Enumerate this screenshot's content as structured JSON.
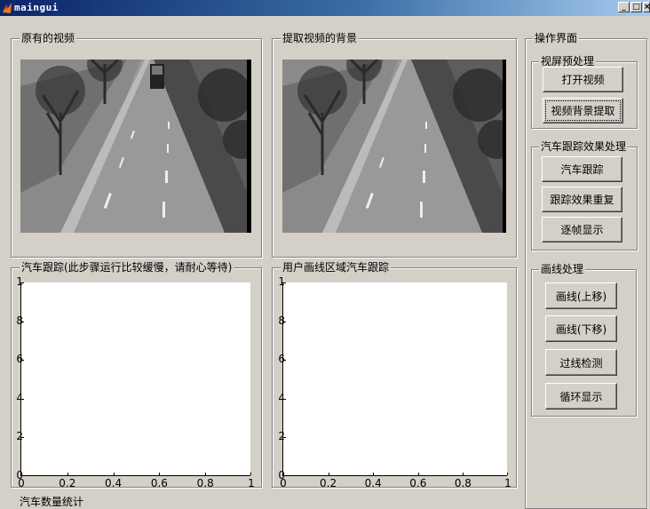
{
  "window": {
    "title": "maingui",
    "minimize_glyph": "_",
    "maximize_glyph": "□",
    "close_glyph": "×"
  },
  "panels": {
    "original_video": {
      "title": "原有的视频"
    },
    "background_video": {
      "title": "提取视频的背景"
    },
    "car_tracking": {
      "title": "汽车跟踪(此步骤运行比较缓慢，请耐心等待)"
    },
    "user_line_tracking": {
      "title": "用户画线区域汽车跟踪"
    },
    "operation": {
      "title": "操作界面"
    },
    "preprocess": {
      "title": "视屏预处理",
      "open_video": "打开视频",
      "extract_background": "视频背景提取"
    },
    "tracking_effect": {
      "title": "汽车跟踪效果处理",
      "car_tracking": "汽车跟踪",
      "replay_effect": "跟踪效果重复",
      "frame_by_frame": "逐帧显示"
    },
    "line_processing": {
      "title": "画线处理",
      "line_up": "画线(上移)",
      "line_down": "画线(下移)",
      "cross_line_detect": "过线检测",
      "loop_display": "循环显示"
    }
  },
  "axes": {
    "yticks": [
      "0",
      "2",
      "4",
      "6",
      "8",
      "1"
    ],
    "xticks": [
      "0",
      "0.2",
      "0.4",
      "0.6",
      "0.8",
      "1"
    ]
  },
  "bottom": {
    "label": "汽车数量统计"
  }
}
